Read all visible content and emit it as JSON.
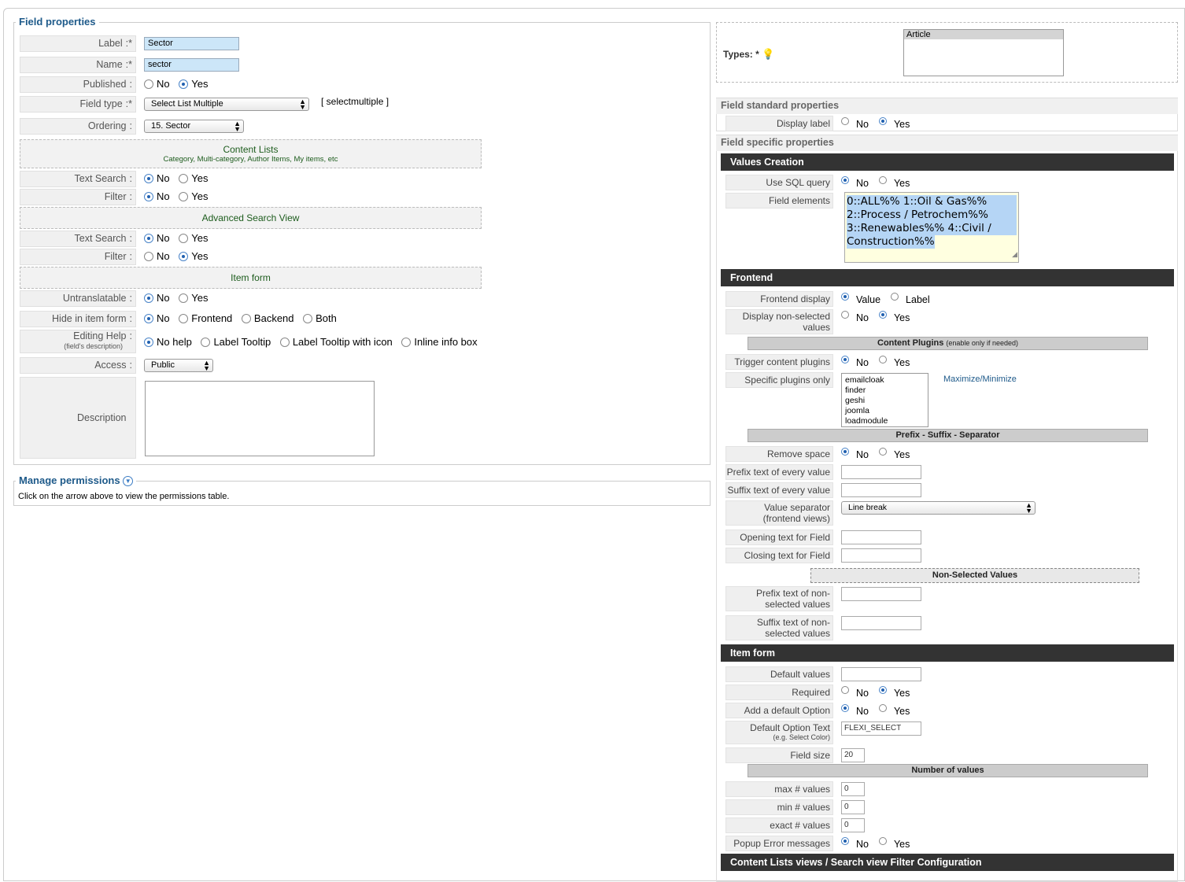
{
  "left": {
    "legend": "Field properties",
    "label": {
      "label": "Label",
      "value": "Sector"
    },
    "name": {
      "label": "Name",
      "value": "sector"
    },
    "published": {
      "label": "Published",
      "no": "No",
      "yes": "Yes"
    },
    "field_type": {
      "label": "Field type",
      "value": "Select List Multiple",
      "code": "[ selectmultiple ]"
    },
    "ordering": {
      "label": "Ordering",
      "value": "15. Sector"
    },
    "content_lists": {
      "title": "Content Lists",
      "subtitle": "Category, Multi-category, Author Items, My items, etc"
    },
    "text_search": {
      "label": "Text Search",
      "no": "No",
      "yes": "Yes"
    },
    "filter": {
      "label": "Filter",
      "no": "No",
      "yes": "Yes"
    },
    "adv_search": {
      "title": "Advanced Search View"
    },
    "adv_text_search": {
      "label": "Text Search",
      "no": "No",
      "yes": "Yes"
    },
    "adv_filter": {
      "label": "Filter",
      "no": "No",
      "yes": "Yes"
    },
    "item_form": {
      "title": "Item form"
    },
    "untranslatable": {
      "label": "Untranslatable",
      "no": "No",
      "yes": "Yes"
    },
    "hide": {
      "label": "Hide in item form",
      "options": [
        "No",
        "Frontend",
        "Backend",
        "Both"
      ]
    },
    "help": {
      "label": "Editing Help",
      "sublabel": "(field's description)",
      "options": [
        "No help",
        "Label Tooltip",
        "Label Tooltip with icon",
        "Inline info box"
      ]
    },
    "access": {
      "label": "Access",
      "value": "Public"
    },
    "description": {
      "label": "Description"
    },
    "required_mark": ":*",
    "colon": ":"
  },
  "permissions": {
    "legend": "Manage permissions",
    "text": "Click on the arrow above to view the permissions table."
  },
  "right": {
    "types": {
      "label": "Types: *",
      "selected": "Article"
    },
    "std_header": "Field standard properties",
    "display_label": {
      "label": "Display label",
      "no": "No",
      "yes": "Yes"
    },
    "spec_header": "Field specific properties",
    "values_creation": "Values Creation",
    "use_sql": {
      "label": "Use SQL query",
      "no": "No",
      "yes": "Yes"
    },
    "field_elements": {
      "label": "Field elements",
      "value": "0::ALL%% 1::Oil & Gas%% 2::Process / Petrochem%% 3::Renewables%% 4::Civil / Construction%%",
      "lines": [
        "0::ALL%% 1::Oil & Gas%%",
        "2::Process / Petrochem%%",
        "3::Renewables%% 4::Civil /",
        "Construction%%"
      ]
    },
    "frontend": "Frontend",
    "frontend_display": {
      "label": "Frontend display",
      "value": "Value",
      "labelopt": "Label"
    },
    "display_non_selected": {
      "label": "Display non-selected values",
      "l1": "Display non-selected",
      "l2": "values",
      "no": "No",
      "yes": "Yes"
    },
    "content_plugins": {
      "title": "Content Plugins",
      "note": "(enable only if needed)"
    },
    "trigger": {
      "label": "Trigger content plugins",
      "no": "No",
      "yes": "Yes"
    },
    "specific_plugins": {
      "label": "Specific plugins only",
      "items": [
        "emailcloak",
        "finder",
        "geshi",
        "joomla",
        "loadmodule"
      ],
      "toggle": "Maximize/Minimize"
    },
    "prefix_suffix": "Prefix - Suffix - Separator",
    "remove_space": {
      "label": "Remove space",
      "no": "No",
      "yes": "Yes"
    },
    "prefix_every": {
      "label": "Prefix text of every value",
      "value": ""
    },
    "suffix_every": {
      "label": "Suffix text of every value",
      "value": ""
    },
    "value_separator": {
      "l1": "Value separator",
      "l2": "(frontend views)",
      "value": "Line break"
    },
    "opening": {
      "label": "Opening text for Field",
      "value": ""
    },
    "closing": {
      "label": "Closing text for Field",
      "value": ""
    },
    "non_selected": "Non-Selected Values",
    "prefix_non": {
      "l1": "Prefix text of non-",
      "l2": "selected values",
      "value": ""
    },
    "suffix_non": {
      "l1": "Suffix text of non-",
      "l2": "selected values",
      "value": ""
    },
    "item_form": "Item form",
    "default_values": {
      "label": "Default values",
      "value": ""
    },
    "required": {
      "label": "Required",
      "no": "No",
      "yes": "Yes"
    },
    "add_default": {
      "label": "Add a default Option",
      "no": "No",
      "yes": "Yes"
    },
    "default_text": {
      "l1": "Default Option Text",
      "l2": "(e.g. Select Color)",
      "value": "FLEXI_SELECT"
    },
    "field_size": {
      "label": "Field size",
      "value": "20"
    },
    "num_values": "Number of values",
    "max_values": {
      "label": "max # values",
      "value": "0"
    },
    "min_values": {
      "label": "min # values",
      "value": "0"
    },
    "exact_values": {
      "label": "exact # values",
      "value": "0"
    },
    "popup": {
      "label": "Popup Error messages",
      "no": "No",
      "yes": "Yes"
    },
    "content_lists_bar": "Content Lists views / Search view Filter Configuration"
  }
}
